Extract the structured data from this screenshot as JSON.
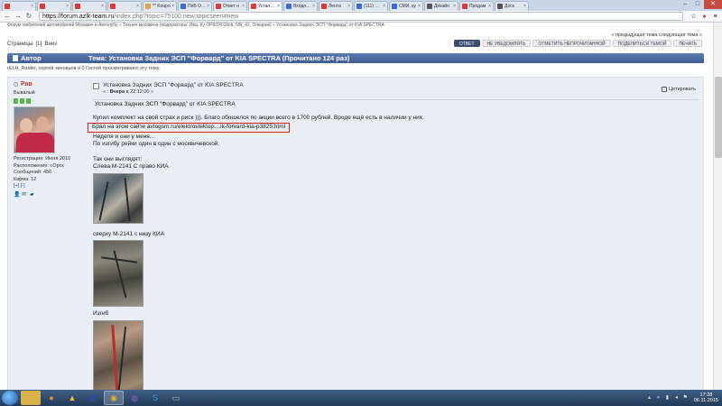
{
  "browser": {
    "tabs": [
      {
        "label": "",
        "color": "#d83a3a"
      },
      {
        "label": "",
        "color": "#d83a3a"
      },
      {
        "label": "",
        "color": "#d83a3a"
      },
      {
        "label": "",
        "color": "#d83a3a"
      },
      {
        "label": "** Koupo",
        "color": "#e3a33a"
      },
      {
        "label": "ПеБ Опети",
        "color": "#3a6ad8"
      },
      {
        "label": "Ответ н",
        "color": "#d83a3a"
      },
      {
        "label": "Установк",
        "color": "#d83a3a",
        "active": true
      },
      {
        "label": "Входящи",
        "color": "#3a6ad8"
      },
      {
        "label": "Лента",
        "color": "#d83a3a"
      },
      {
        "label": "(111) Новос",
        "color": "#3a6ad8"
      },
      {
        "label": "СМИ, ку",
        "color": "#3a6ad8"
      },
      {
        "label": "Дизайн",
        "color": "#555555"
      },
      {
        "label": "Продам",
        "color": "#d83a3a"
      },
      {
        "label": "Доск",
        "color": "#555555"
      }
    ],
    "url_host": "https://forum.azlk-team.ru",
    "url_path": "/index.php?topic=75100.new;topicseen#new",
    "nav": {
      "back": "←",
      "forward": "→",
      "reload": "↻"
    },
    "toolbar_icons": [
      "star-icon",
      "extension-icon",
      "menu-icon"
    ]
  },
  "forum": {
    "breadcrumb": "Форум любителей автомобилей Москвич и Автолубу » Технич москвича (модераторы: Ива, Ку ОРКОЯ 02ob, NN_42, Очкарик) » Установка Задних ЭСП \"Форвард\" от KIA SPECTRA",
    "prevnext": "« предыдущая тема следующая тема »",
    "pages_label": "Страницы:",
    "pages_current": "[1]",
    "pages_up": "Вниз",
    "buttons": [
      {
        "label": "Ответ",
        "primary": true
      },
      {
        "label": "Не уведомлять",
        "primary": false
      },
      {
        "label": "Отметить непрочитанной",
        "primary": false
      },
      {
        "label": "Поделиться темой",
        "primary": false
      },
      {
        "label": "Печать",
        "primary": false
      }
    ],
    "header_author": "Автор",
    "header_topic": "Тема: Установка Задних ЭСП \"Форвард\" от KIA SPECTRA  (Прочитано 124 раз)",
    "viewers": "rELH_Raider, сергей зиновьев и 0 Гостей просматривают эту тему."
  },
  "post": {
    "author": "Рав",
    "rank": "Бывалый",
    "reg": "Регистрация: Июня 2010",
    "location": "Расположение: г.Орск",
    "messages": "Сообщений: 456",
    "karma": "Карма: 12",
    "karma_controls": "[+] [-]",
    "subject": "Установка Задних ЭСП \"Форвард\" от KIA SPECTRA",
    "when_prefix": "« :",
    "when_bold": "Вчера",
    "when_time": "в 22:12:00 »",
    "quote_label": "Цитировать",
    "lines": {
      "title": "Установка Задних ЭСП \"Форвард\" от KIA SPECTRA",
      "l1": "Купил комплект на свой страх и риск ))). Благо обошелся по акции всего в 1700 рублей. Вроде ещё есть в наличии у них.",
      "link": "Брал на этом сайте avtogsm.ru/elektrosteklop....ik-forvard-kia-p3825.html",
      "l3": "Неделя и они у меня...",
      "l4": "По изгибу рейки один в один с москвичевской.",
      "l5": "Так они выглядят:",
      "l6": "Слева М-2141 С право КИА",
      "l7": "сверху М-2141 с низу КИА",
      "l8": "Изгиб"
    }
  },
  "taskbar": {
    "apps": [
      "folder-icon",
      "firefox-icon",
      "opera-icon",
      "save-icon",
      "chrome-icon",
      "viber-icon",
      "skype-icon",
      "app-icon"
    ],
    "time": "17:28",
    "date": "06.11.2015"
  }
}
